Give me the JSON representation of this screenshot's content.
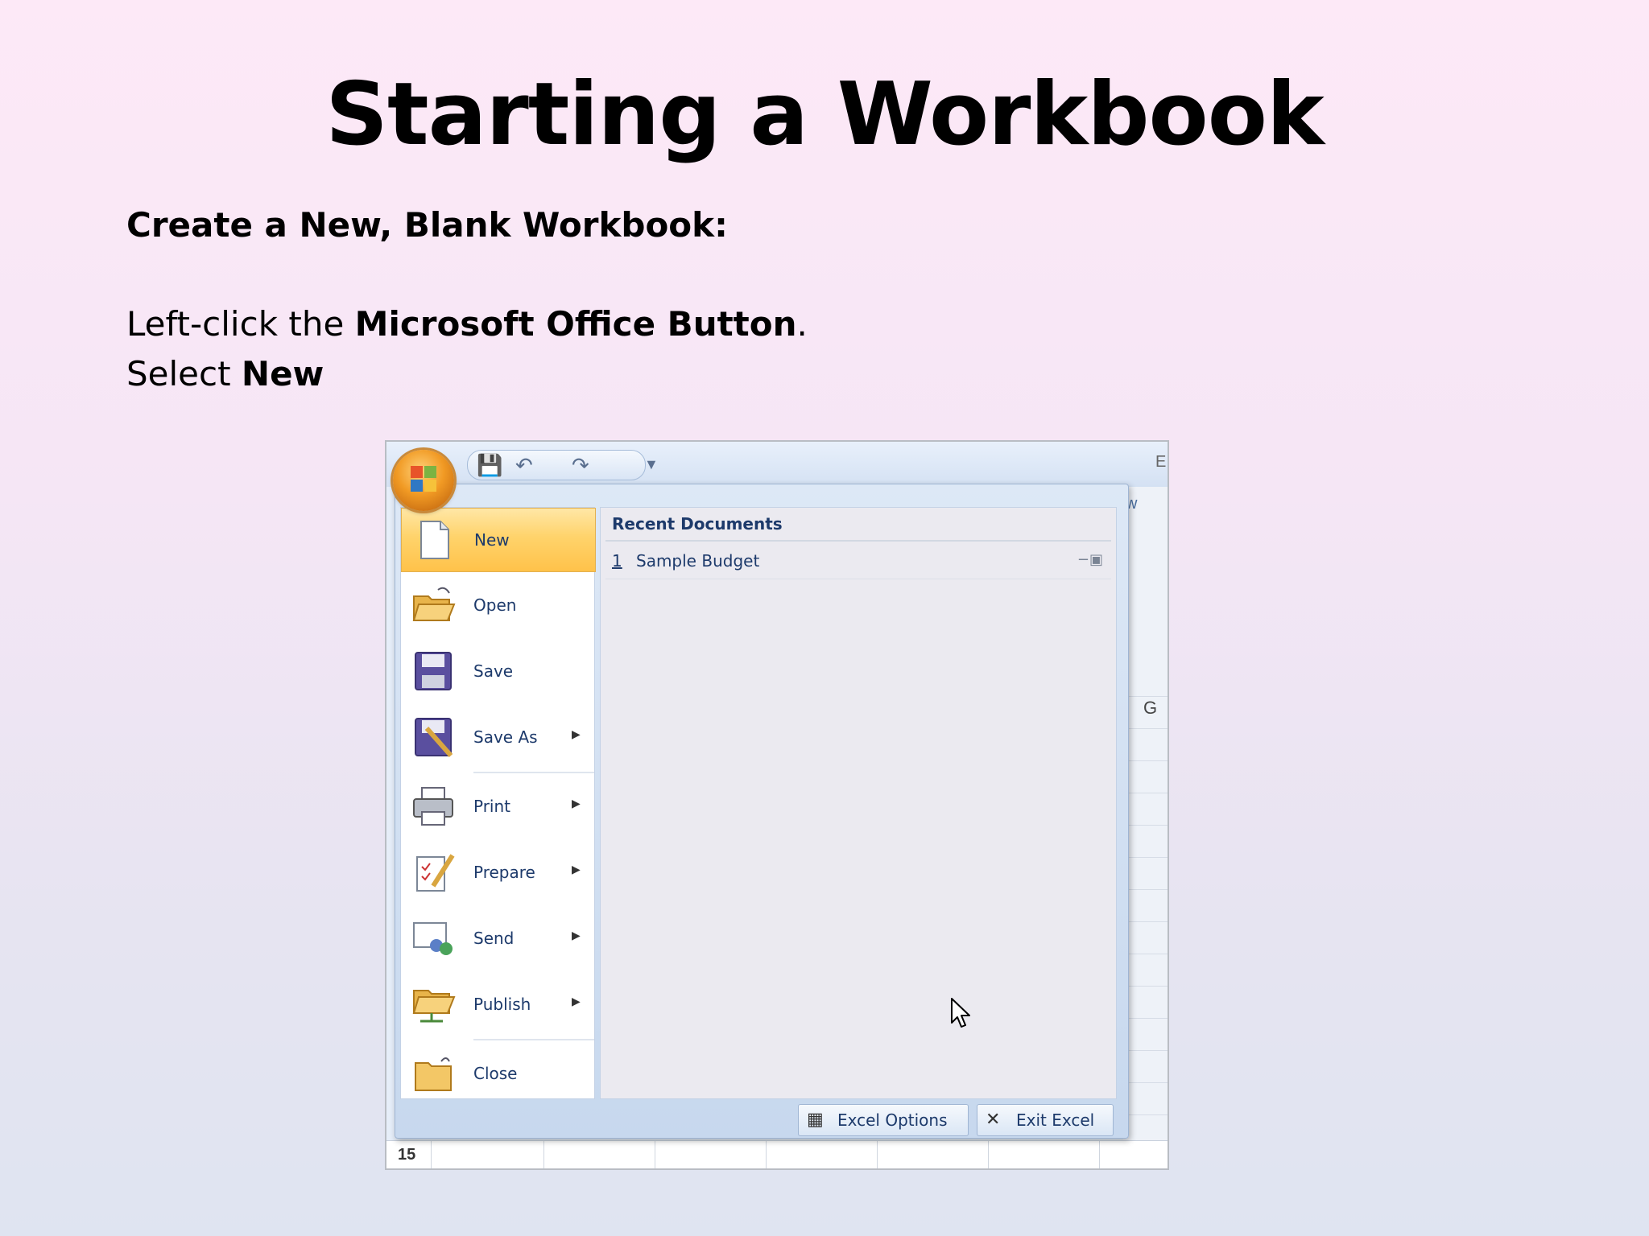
{
  "slide": {
    "title": "Starting a Workbook",
    "subhead": "Create a New, Blank Workbook:",
    "line1_prefix": "Left-click the ",
    "line1_bold": "Microsoft Office Button",
    "line1_suffix": ".",
    "line2_prefix": "Select ",
    "line2_bold": "New"
  },
  "screenshot": {
    "bg_letters": {
      "e": "E",
      "w": "w",
      "g": "G"
    },
    "row_number": "15",
    "menu": {
      "items": [
        {
          "label": "New",
          "icon": "blank-document-icon",
          "submenu": false,
          "selected": true
        },
        {
          "label": "Open",
          "icon": "open-folder-icon",
          "submenu": false
        },
        {
          "label": "Save",
          "icon": "floppy-disk-icon",
          "submenu": false
        },
        {
          "label": "Save As",
          "icon": "save-as-icon",
          "submenu": true
        },
        {
          "label": "Print",
          "icon": "printer-icon",
          "submenu": true
        },
        {
          "label": "Prepare",
          "icon": "prepare-document-icon",
          "submenu": true
        },
        {
          "label": "Send",
          "icon": "send-icon",
          "submenu": true
        },
        {
          "label": "Publish",
          "icon": "publish-folder-icon",
          "submenu": true
        },
        {
          "label": "Close",
          "icon": "close-folder-icon",
          "submenu": false
        }
      ],
      "recent_header": "Recent Documents",
      "recent": [
        {
          "number": "1",
          "name": "Sample Budget"
        }
      ],
      "footer": {
        "options_label": "Excel Options",
        "exit_label": "Exit Excel"
      }
    }
  }
}
